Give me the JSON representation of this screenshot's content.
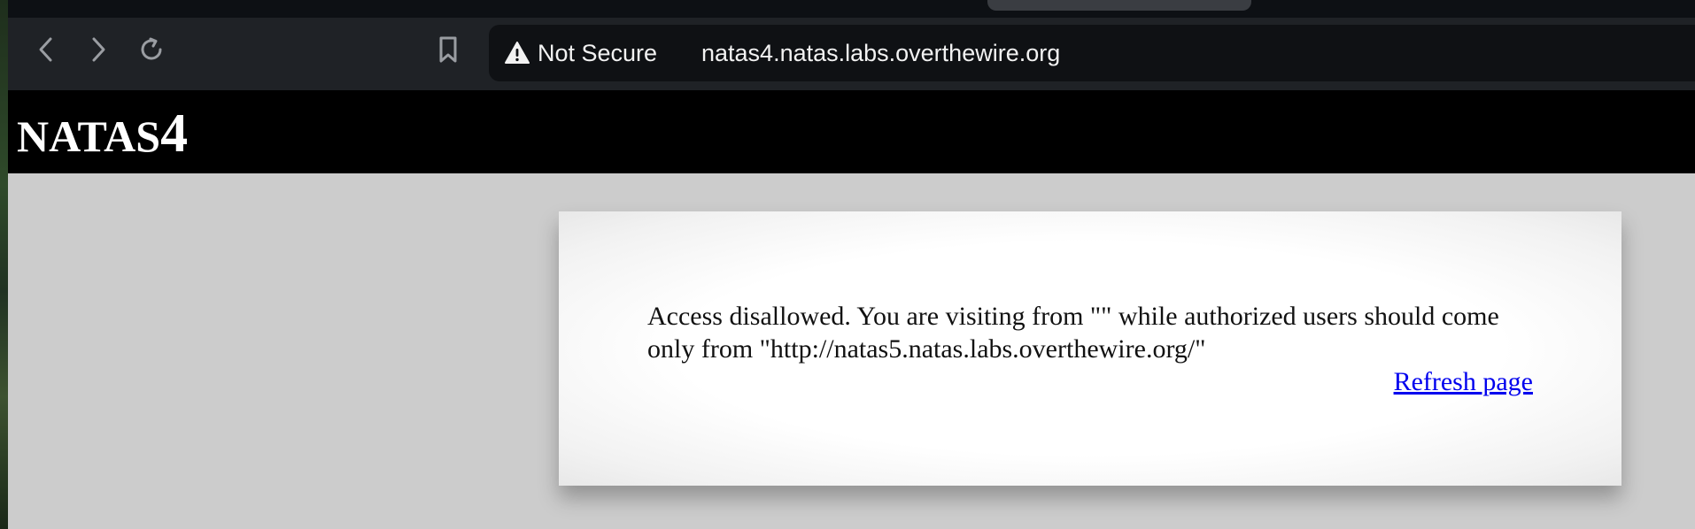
{
  "browser": {
    "back_icon": "chevron-left-icon",
    "forward_icon": "chevron-right-icon",
    "reload_icon": "reload-icon",
    "bookmark_icon": "bookmark-icon",
    "security_icon": "warning-icon",
    "security_label": "Not Secure",
    "url": "natas4.natas.labs.overthewire.org"
  },
  "site": {
    "title_word": "NATAS",
    "title_number": "4"
  },
  "content": {
    "message": "Access disallowed. You are visiting from \"\" while authorized users should come only from \"http://natas5.natas.labs.overthewire.org/\"",
    "refresh_link": "Refresh page"
  },
  "colors": {
    "header_background": "#000000",
    "page_background": "#cccccc",
    "link": "#0000ee",
    "toolbar": "#1f2226"
  }
}
